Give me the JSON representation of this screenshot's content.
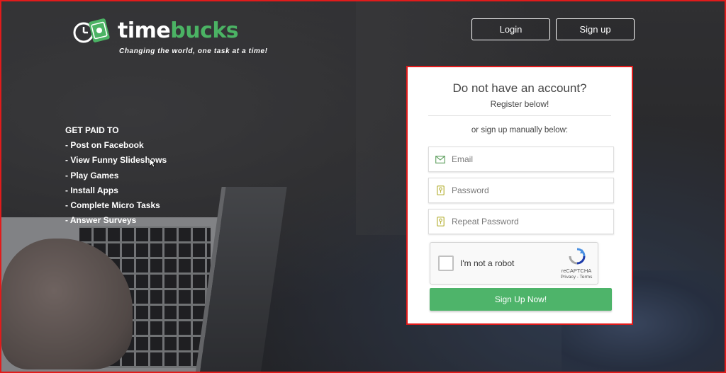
{
  "brand": {
    "name_part1": "time",
    "name_part2": "bucks",
    "tagline": "Changing the world, one task at a time!",
    "accent_color": "#4bb364"
  },
  "nav": {
    "login_label": "Login",
    "signup_label": "Sign up"
  },
  "promo": {
    "heading": "GET PAID TO",
    "items": [
      "- Post on Facebook",
      "- View Funny Slideshows",
      "- Play Games",
      "- Install Apps",
      "- Complete Micro Tasks",
      "- Answer Surveys"
    ]
  },
  "register": {
    "title": "Do not have an account?",
    "subtitle": "Register below!",
    "manual_text": "or sign up manually below:",
    "email_placeholder": "Email",
    "password_placeholder": "Password",
    "repeat_password_placeholder": "Repeat Password",
    "captcha": {
      "label": "I'm not a robot",
      "brand": "reCAPTCHA",
      "links": "Privacy - Terms"
    },
    "submit_label": "Sign Up Now!",
    "submit_color": "#4eb46a"
  },
  "highlight_color": "#e11b1b"
}
